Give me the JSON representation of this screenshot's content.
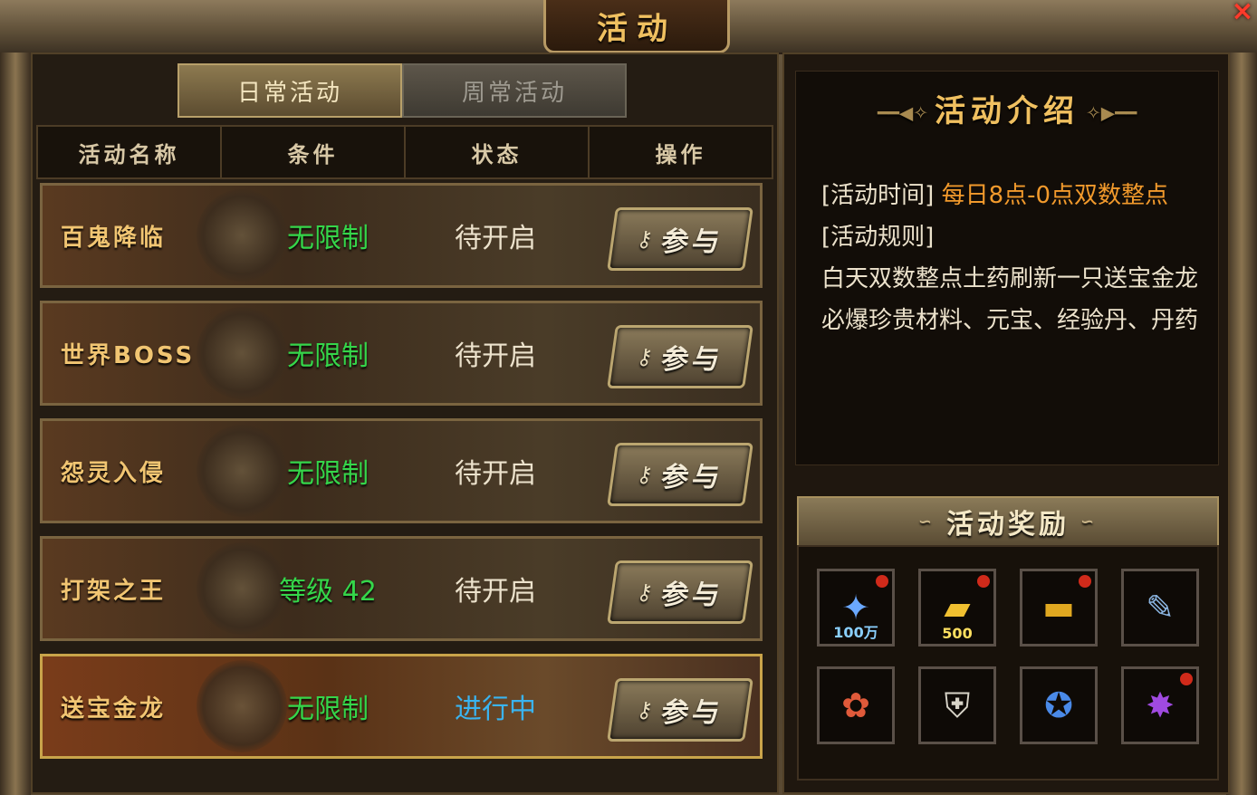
{
  "window": {
    "title": "活动",
    "close_icon": "×"
  },
  "tabs": [
    {
      "label": "日常活动",
      "active": true
    },
    {
      "label": "周常活动",
      "active": false
    }
  ],
  "table": {
    "headers": [
      "活动名称",
      "条件",
      "状态",
      "操作"
    ],
    "rows": [
      {
        "name": "百鬼降临",
        "condition": "无限制",
        "status": "待开启",
        "action": "参与"
      },
      {
        "name": "世界BOSS",
        "condition": "无限制",
        "status": "待开启",
        "action": "参与"
      },
      {
        "name": "怨灵入侵",
        "condition": "无限制",
        "status": "待开启",
        "action": "参与"
      },
      {
        "name": "打架之王",
        "condition": "等级 42",
        "status": "待开启",
        "action": "参与"
      },
      {
        "name": "送宝金龙",
        "condition": "无限制",
        "status": "进行中",
        "action": "参与"
      }
    ]
  },
  "intro": {
    "title": "活动介绍",
    "time_label": "[活动时间]",
    "time_value": "每日8点-0点双数整点",
    "rules_label": "[活动规则]",
    "rules_lines": [
      "白天双数整点土药刷新一只送宝金龙",
      "必爆珍贵材料、元宝、经验丹、丹药"
    ]
  },
  "rewards": {
    "title": "活动奖励",
    "items": [
      {
        "icon": "blue-gem-icon",
        "qty": "100万",
        "glyph": "✦",
        "glyph_color": "#6aa8ff",
        "qty_color": "#8ad0ff",
        "badge": true
      },
      {
        "icon": "gold-ingot-icon",
        "qty": "500",
        "glyph": "▰",
        "glyph_color": "#f0c030",
        "qty_color": "#ffe060",
        "badge": true
      },
      {
        "icon": "gold-bar-icon",
        "qty": "",
        "glyph": "▬",
        "glyph_color": "#e0a820",
        "qty_color": "#ffe060",
        "badge": true
      },
      {
        "icon": "scroll-icon",
        "qty": "",
        "glyph": "✎",
        "glyph_color": "#8ab4e0",
        "qty_color": "#ffffff",
        "badge": false
      },
      {
        "icon": "red-flower-icon",
        "qty": "",
        "glyph": "✿",
        "glyph_color": "#e05a3a",
        "qty_color": "#ffffff",
        "badge": false
      },
      {
        "icon": "shield-icon",
        "qty": "",
        "glyph": "⛨",
        "glyph_color": "#d8d4c8",
        "qty_color": "#ffffff",
        "badge": false
      },
      {
        "icon": "blue-orb-icon",
        "qty": "",
        "glyph": "✪",
        "glyph_color": "#4a8ae8",
        "qty_color": "#ffffff",
        "badge": false
      },
      {
        "icon": "purple-orb-icon",
        "qty": "",
        "glyph": "✸",
        "glyph_color": "#a04ae0",
        "qty_color": "#ffffff",
        "badge": true
      }
    ]
  }
}
